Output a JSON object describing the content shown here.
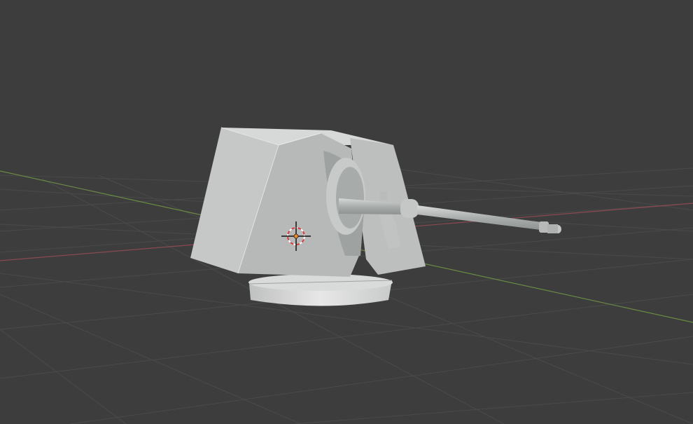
{
  "viewport": {
    "background": "#3d3d3d",
    "grid_color": "#4a4a4a",
    "x_axis_color": "#8a4a52",
    "y_axis_color": "#6a8a44",
    "scene_object": "naval-gun-turret",
    "cursor_icon": "3d-cursor-icon"
  }
}
